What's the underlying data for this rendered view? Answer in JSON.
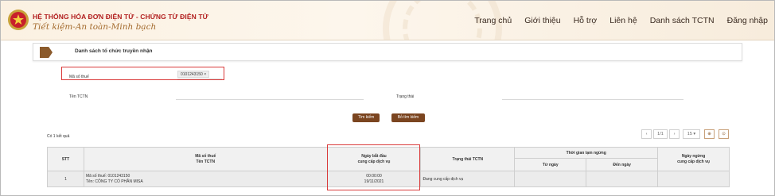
{
  "header": {
    "title": "HỆ THỐNG HÓA ĐƠN ĐIỆN TỬ - CHỨNG TỪ ĐIỆN TỬ",
    "slogan": "Tiết kiệm-An toàn-Minh bạch",
    "nav": [
      "Trang chủ",
      "Giới thiệu",
      "Hỗ trợ",
      "Liên hệ",
      "Danh sách TCTN",
      "Đăng nhập"
    ]
  },
  "section": {
    "title": "Danh sách tổ chức truyền nhận"
  },
  "form": {
    "tax_label": "Mã số thuế",
    "tax_value": "0101243150",
    "tag_remove": "×",
    "name_label": "Tên TCTN",
    "name_value": "",
    "status_label": "Trạng thái",
    "status_value": "",
    "search_button": "Tìm kiếm",
    "clear_button": "Bỏ tìm kiếm"
  },
  "results": {
    "count_text": "Có 1 kết quả"
  },
  "pager": {
    "prev": "‹",
    "page": "1/1",
    "next": "›",
    "page_size": "15 ▾",
    "icon_a": "⊕",
    "icon_b": "⊙"
  },
  "table": {
    "headers": {
      "stt": "STT",
      "tax_line1": "Mã số thuế",
      "tax_line2": "Tên TCTN",
      "start_line1": "Ngày bắt đầu",
      "start_line2": "cung cấp dịch vụ",
      "status": "Trạng thái TCTN",
      "pause": "Thời gian tạm ngừng",
      "from": "Từ ngày",
      "to": "Đến ngày",
      "stop_line1": "Ngày ngừng",
      "stop_line2": "cung cấp dịch vụ"
    },
    "rows": [
      {
        "stt": "1",
        "tax": "Mã số thuế: 0101243150",
        "name": "Tên: CÔNG TY CỔ PHẦN MISA",
        "start_time": "00:00:00",
        "start_date": "19/11/2021",
        "status": "Đang cung cấp dịch vụ",
        "from": "",
        "to": "",
        "stop": ""
      }
    ]
  },
  "colors": {
    "accent": "#7b4520",
    "highlight": "#d93a3a",
    "brand_red": "#b21f1f"
  }
}
